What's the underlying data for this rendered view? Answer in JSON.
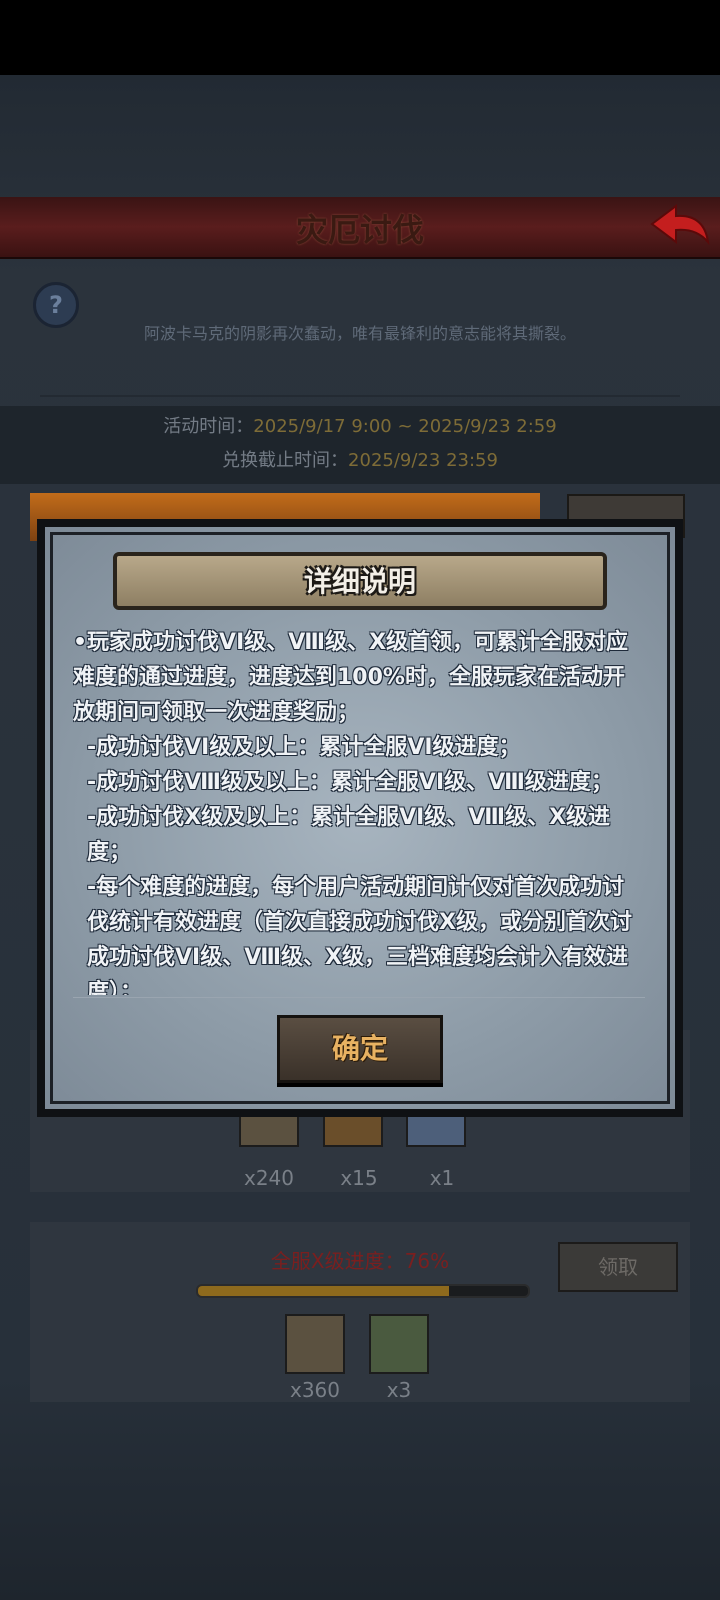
{
  "header": {
    "title": "灾厄讨伐"
  },
  "intro": "阿波卡马克的阴影再次蠢动，唯有最锋利的意志能将其撕裂。",
  "times": {
    "activity_label": "活动时间：",
    "activity_value": "2025/9/17 9:00 ~ 2025/9/23 2:59",
    "exchange_label": "兑换截止时间：",
    "exchange_value": "2025/9/23 23:59"
  },
  "help_icon": "?",
  "tier1_rewards": [
    {
      "icon": "scroll-icon",
      "count": "x240"
    },
    {
      "icon": "chest-icon",
      "count": "x15"
    },
    {
      "icon": "crystal-icon",
      "count": "x1"
    }
  ],
  "tier2": {
    "progress_label": "全服X级进度：76%",
    "progress": 0.76,
    "claim_label": "领取",
    "rewards": [
      {
        "icon": "scroll-icon",
        "count": "x360"
      },
      {
        "icon": "potion-pack-icon",
        "count": "x3"
      }
    ]
  },
  "modal": {
    "title": "详细说明",
    "lines": [
      "•玩家成功讨伐VI级、Ⅷ级、X级首领，可累计全服对应难度的通过进度，进度达到100%时，全服玩家在活动开放期间可领取一次进度奖励；",
      "-成功讨伐VI级及以上：累计全服VI级进度；",
      "-成功讨伐Ⅷ级及以上：累计全服VI级、Ⅷ级进度；",
      "-成功讨伐X级及以上：累计全服VI级、Ⅷ级、X级进度；",
      "-每个难度的进度，每个用户活动期间计仅对首次成功讨伐统计有效进度（首次直接成功讨伐X级，或分别首次讨成功讨伐VI级、Ⅷ级、X级，三档难度均会计入有效进度）；"
    ],
    "confirm_label": "确定"
  },
  "colors": {
    "accent_orange": "#e8b262",
    "progress_red": "#7a1f1f",
    "header_red": "#5a1d1d"
  }
}
